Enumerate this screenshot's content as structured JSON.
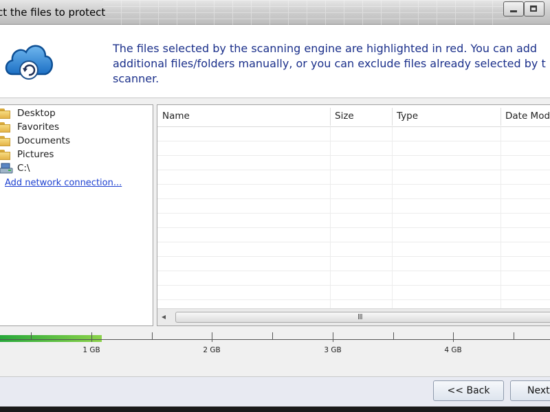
{
  "window": {
    "title": "ct the files to protect"
  },
  "header": {
    "icon": "cloud-restore-icon",
    "message": "The files selected by the scanning engine are highlighted in red.  You can add\nadditional files/folders manually, or you can exclude files already selected by t\nscanner."
  },
  "tree": {
    "items": [
      {
        "label": "Desktop",
        "icon": "folder-icon"
      },
      {
        "label": "Favorites",
        "icon": "folder-icon"
      },
      {
        "label": "Documents",
        "icon": "folder-icon"
      },
      {
        "label": "Pictures",
        "icon": "folder-icon"
      },
      {
        "label": "C:\\",
        "icon": "drive-icon"
      }
    ],
    "add_network_link": "Add network connection..."
  },
  "file_list": {
    "columns": [
      "Name",
      "Size",
      "Type",
      "Date Modif"
    ],
    "rows": [],
    "scroll_grip": "III"
  },
  "storage_gauge": {
    "used_gb": 1.1,
    "labels": [
      "1 GB",
      "2 GB",
      "3 GB",
      "4 GB"
    ],
    "fill_color": "#2fae3e"
  },
  "footer": {
    "back_label": "<< Back",
    "next_label": "Next"
  }
}
